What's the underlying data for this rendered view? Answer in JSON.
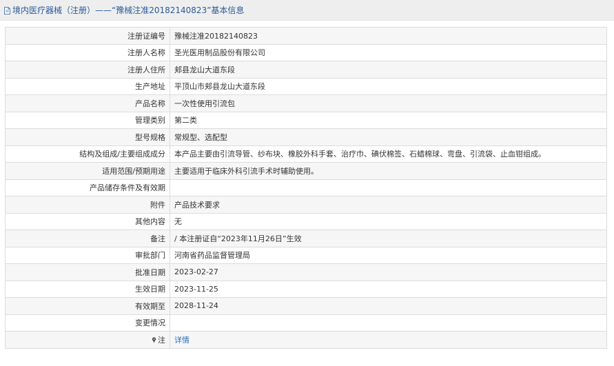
{
  "header": {
    "title": "境内医疗器械（注册）——“豫械注准20182140823”基本信息",
    "icon": "document-icon"
  },
  "rows": [
    {
      "label": "注册证编号",
      "value": "豫械注准20182140823"
    },
    {
      "label": "注册人名称",
      "value": "圣光医用制品股份有限公司"
    },
    {
      "label": "注册人住所",
      "value": "郏县龙山大道东段"
    },
    {
      "label": "生产地址",
      "value": "平顶山市郏县龙山大道东段"
    },
    {
      "label": "产品名称",
      "value": "一次性使用引流包"
    },
    {
      "label": "管理类别",
      "value": "第二类"
    },
    {
      "label": "型号规格",
      "value": "常规型、选配型"
    },
    {
      "label": "结构及组成/主要组成成分",
      "value": "本产品主要由引流导管、纱布块、橡胶外科手套、治疗巾、碘伏棉签、石蜡棉球、弯盘、引流袋、止血钳组成。"
    },
    {
      "label": "适用范围/预期用途",
      "value": "主要适用于临床外科引流手术时辅助使用。"
    },
    {
      "label": "产品储存条件及有效期",
      "value": ""
    },
    {
      "label": "附件",
      "value": "产品技术要求"
    },
    {
      "label": "其他内容",
      "value": "无"
    },
    {
      "label": "备注",
      "value": "/ 本注册证自“2023年11月26日”生效"
    },
    {
      "label": "审批部门",
      "value": "河南省药品监督管理局"
    },
    {
      "label": "批准日期",
      "value": "2023-02-27"
    },
    {
      "label": "生效日期",
      "value": "2023-11-25"
    },
    {
      "label": "有效期至",
      "value": "2028-11-24"
    },
    {
      "label": "变更情况",
      "value": ""
    }
  ],
  "note_row": {
    "label": "注",
    "icon": "pin-icon",
    "link_text": "详情"
  }
}
